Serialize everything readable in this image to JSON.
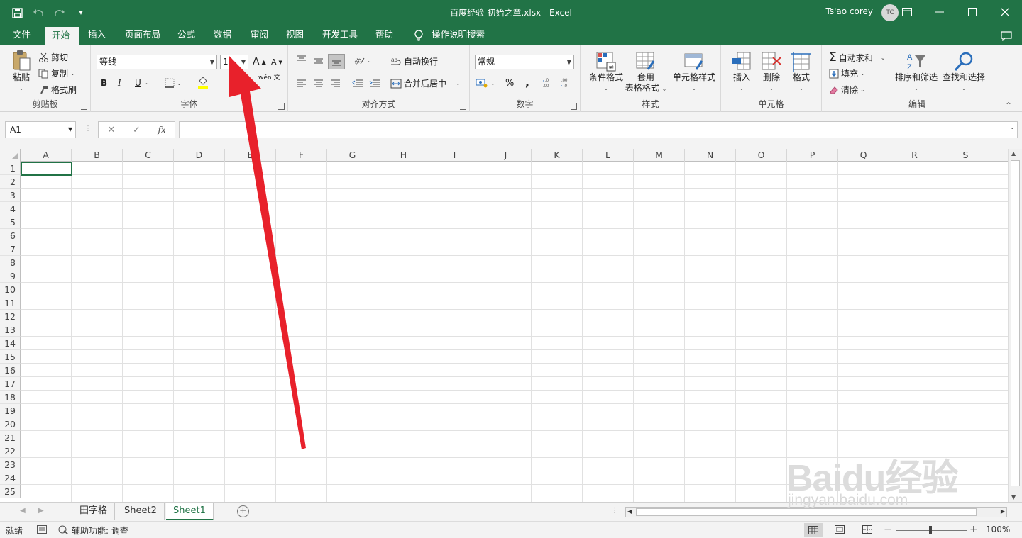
{
  "titlebar": {
    "title": "百度经验-初始之章.xlsx  -  Excel",
    "user": "Ts'ao corey",
    "avatar": "TC",
    "accent": "#217346",
    "qat_icons": [
      "save-icon",
      "undo-icon",
      "redo-icon",
      "customize-icon"
    ]
  },
  "tabs": [
    {
      "label": "文件",
      "active": false
    },
    {
      "label": "开始",
      "active": true
    },
    {
      "label": "插入",
      "active": false
    },
    {
      "label": "页面布局",
      "active": false
    },
    {
      "label": "公式",
      "active": false
    },
    {
      "label": "数据",
      "active": false
    },
    {
      "label": "审阅",
      "active": false
    },
    {
      "label": "视图",
      "active": false
    },
    {
      "label": "开发工具",
      "active": false
    },
    {
      "label": "帮助",
      "active": false
    }
  ],
  "tellme": "操作说明搜索",
  "ribbon": {
    "clipboard": {
      "label": "剪贴板",
      "paste": "粘贴",
      "cut": "剪切",
      "copy": "复制",
      "format_painter": "格式刷"
    },
    "font": {
      "label": "字体",
      "font_name": "等线",
      "font_size": "11",
      "bold": "B",
      "italic": "I",
      "underline": "U",
      "phonetic": "wén 文"
    },
    "alignment": {
      "label": "对齐方式",
      "wrap": "自动换行",
      "merge": "合并后居中"
    },
    "number": {
      "label": "数字",
      "format": "常规",
      "percent": "%",
      "comma": ","
    },
    "styles": {
      "label": "样式",
      "conditional": "条件格式",
      "table_format_1": "套用",
      "table_format_2": "表格格式",
      "cell_styles": "单元格样式"
    },
    "cells": {
      "label": "单元格",
      "insert": "插入",
      "delete": "删除",
      "format": "格式"
    },
    "editing": {
      "label": "编辑",
      "autosum": "自动求和",
      "fill": "填充",
      "clear": "清除",
      "sort": "排序和筛选",
      "find": "查找和选择"
    }
  },
  "formula_bar": {
    "name_box": "A1",
    "fx": "fx",
    "value": ""
  },
  "columns": [
    "A",
    "B",
    "C",
    "D",
    "E",
    "F",
    "G",
    "H",
    "I",
    "J",
    "K",
    "L",
    "M",
    "N",
    "O",
    "P",
    "Q",
    "R",
    "S"
  ],
  "rows": [
    "1",
    "2",
    "3",
    "4",
    "5",
    "6",
    "7",
    "8",
    "9",
    "10",
    "11",
    "12",
    "13",
    "14",
    "15",
    "16",
    "17",
    "18",
    "19",
    "20",
    "21",
    "22",
    "23",
    "24",
    "25"
  ],
  "sheets": [
    {
      "label": "田字格",
      "active": false
    },
    {
      "label": "Sheet2",
      "active": false
    },
    {
      "label": "Sheet1",
      "active": true
    }
  ],
  "status": {
    "ready": "就绪",
    "accessibility": "辅助功能: 调查",
    "zoom": "100%"
  },
  "watermark": {
    "line1": "Baidu经验",
    "line2": "jingyan.baidu.com"
  },
  "annotation": {
    "arrow_color": "#e8212b"
  }
}
